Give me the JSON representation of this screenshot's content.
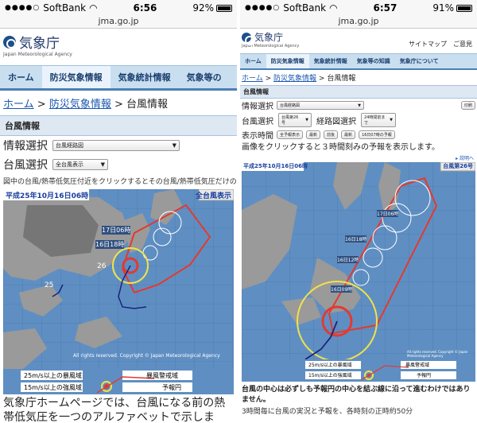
{
  "left": {
    "status": {
      "carrier": "SoftBank",
      "time": "6:56",
      "battery": "92%",
      "battery_level": 0.92
    },
    "url": "jma.go.jp",
    "logo": {
      "title": "気象庁",
      "subtitle": "Japan Meteorological Agency"
    },
    "nav": [
      "ホーム",
      "防災気象情報",
      "気象統計情報",
      "気象等の"
    ],
    "breadcrumb": {
      "home": "ホーム",
      "sep": ">",
      "section": "防災気象情報",
      "page": "台風情報"
    },
    "box_title": "台風情報",
    "info_label": "情報選択",
    "info_select": "台風経路図",
    "typhoon_label": "台風選択",
    "typhoon_select": "全台風表示",
    "note": "図中の台風/熱帯低気圧付近をクリックするとその台風/熱帯低気圧だけの経路",
    "map": {
      "date": "平成25年10月16日06時",
      "badge": "全台風表示",
      "label_17": "17日06時",
      "label_16": "16日18時",
      "label_26": "26",
      "label_25": "25",
      "copyright": "All rights reserved. Copyright © Japan Meteorological Agency"
    },
    "legend": {
      "storm": "25m/s以上の暴風域",
      "strong": "15m/s以上の強風域",
      "warning": "暴風警戒域",
      "forecast": "予報円"
    },
    "bottom_text": "気象庁ホームページでは、台風になる前の熱帯低気圧を一つのアルファベットで示します。"
  },
  "right": {
    "status": {
      "carrier": "SoftBank",
      "time": "6:57",
      "battery": "91%",
      "battery_level": 0.91
    },
    "url": "jma.go.jp",
    "logo": {
      "title": "気象庁",
      "subtitle": "Japan Meteorological Agency"
    },
    "top_links": [
      "サイトマップ",
      "ご意見"
    ],
    "nav": [
      "ホーム",
      "防災気象情報",
      "気象統計情報",
      "気象等の知識",
      "気象庁について"
    ],
    "breadcrumb": {
      "home": "ホーム",
      "sep": ">",
      "section": "防災気象情報",
      "page": "台風情報"
    },
    "box_title": "台風情報",
    "info_label": "情報選択",
    "info_select": "台風経路図",
    "print_button": "印刷",
    "typhoon_label": "台風選択",
    "typhoon_select": "台風第26号",
    "route_label": "経路図選択",
    "route_select": "24時間前まで",
    "time_label": "表示時間",
    "time_buttons": [
      "全予報表示",
      "最新",
      "前後",
      "最新",
      "16日07時の予報"
    ],
    "instruction": "画像をクリックすると３時間刻みの予報を表示します。",
    "explain_link": "説明へ",
    "map": {
      "date": "平成25年10月16日06時",
      "badge": "台風第26号",
      "label_17": "17日06時",
      "label_1618": "16日18時",
      "label_1612": "16日12時",
      "label_1609": "16日09時",
      "copyright": "All rights reserved. Copyright © Japan Meteorological Agency"
    },
    "legend": {
      "storm": "25m/s以上の暴風域",
      "strong": "15m/s以上の強風域",
      "warning": "暴風警戒域",
      "forecast": "予報円"
    },
    "bottom_text_1": "台風の中心は必ずしも予報円の中心を結ぶ線に沿って進むわけではありません。",
    "bottom_text_2": "3時間毎に台風の実況と予報を、各時刻の正時約50分"
  }
}
